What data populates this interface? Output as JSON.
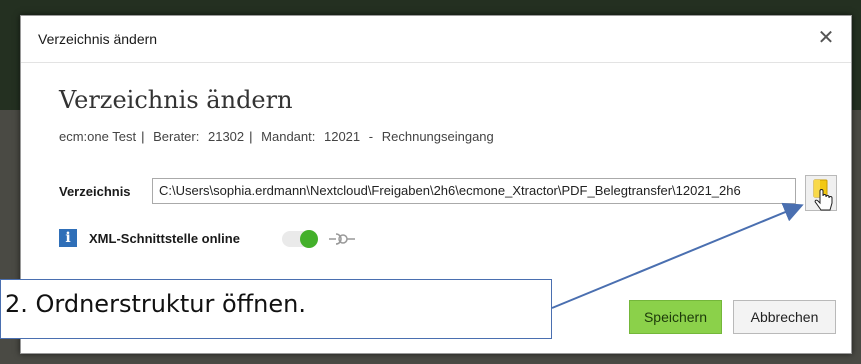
{
  "dialog": {
    "title": "Verzeichnis ändern",
    "close_glyph": "✕",
    "heading": "Verzeichnis ändern",
    "subtitle": {
      "app": "ecm:one Test",
      "berater_label": "Berater:",
      "berater_value": "21302",
      "mandant_label": "Mandant:",
      "mandant_value": "12021",
      "dash": "-",
      "area": "Rechnungseingang"
    },
    "directory": {
      "label": "Verzeichnis",
      "value": "C:\\Users\\sophia.erdmann\\Nextcloud\\Freigaben\\2h6\\ecmone_Xtractor\\PDF_Belegtransfer\\12021_2h6"
    },
    "xml": {
      "label": "XML-Schnittstelle online",
      "info_glyph": "i",
      "toggle_on": true
    },
    "buttons": {
      "save": "Speichern",
      "cancel": "Abbrechen"
    }
  },
  "annotation": {
    "callout_text": "2. Ordnerstruktur öffnen."
  },
  "colors": {
    "accent_green": "#8bd14a",
    "toggle_green": "#43b02a",
    "info_blue": "#2f6fb8",
    "callout_border": "#4a6fb0",
    "folder_yellow": "#f2c811"
  },
  "icons": [
    "close-icon",
    "folder-icon",
    "hand-cursor-icon",
    "info-icon",
    "plug-icon"
  ]
}
